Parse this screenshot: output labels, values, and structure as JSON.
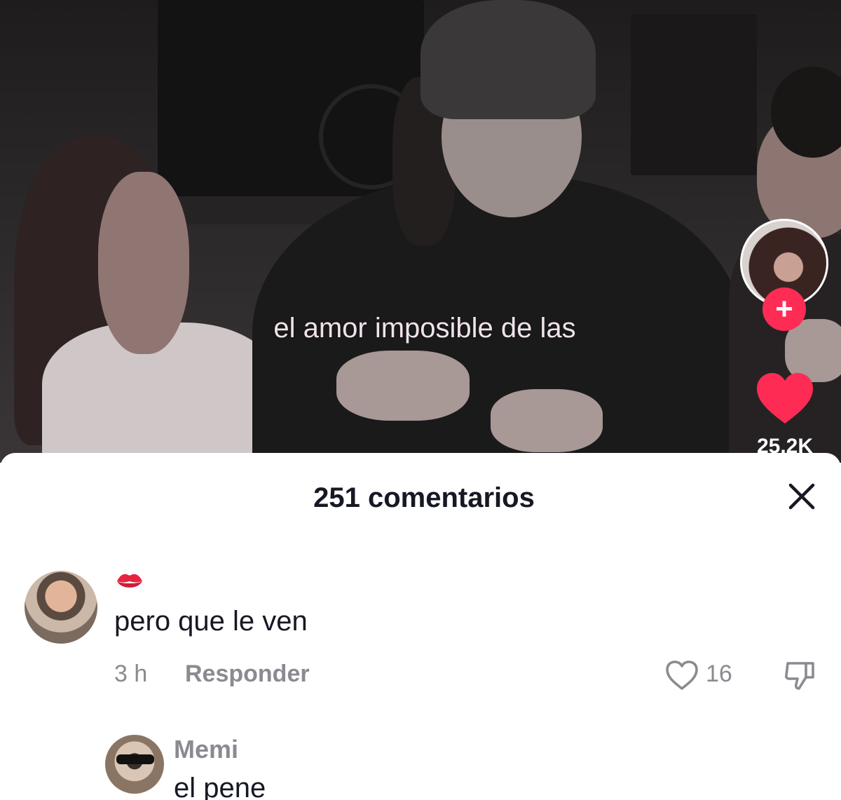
{
  "video": {
    "caption": "el amor imposible de las",
    "like_count": "25.2K",
    "follow_symbol": "+",
    "colors": {
      "accent": "#fe2c55",
      "caption": "#efe2ea"
    }
  },
  "comments_sheet": {
    "title": "251 comentarios",
    "comments": [
      {
        "emoji_icon": "kiss-mark-icon",
        "text": "pero que le ven",
        "time": "3 h",
        "reply_label": "Responder",
        "likes": "16"
      },
      {
        "username": "Memi",
        "text": "el pene"
      }
    ]
  },
  "icons": {
    "close": "close-icon",
    "heart": "heart-icon",
    "heart_outline": "heart-outline-icon",
    "dislike": "thumbs-down-icon"
  }
}
